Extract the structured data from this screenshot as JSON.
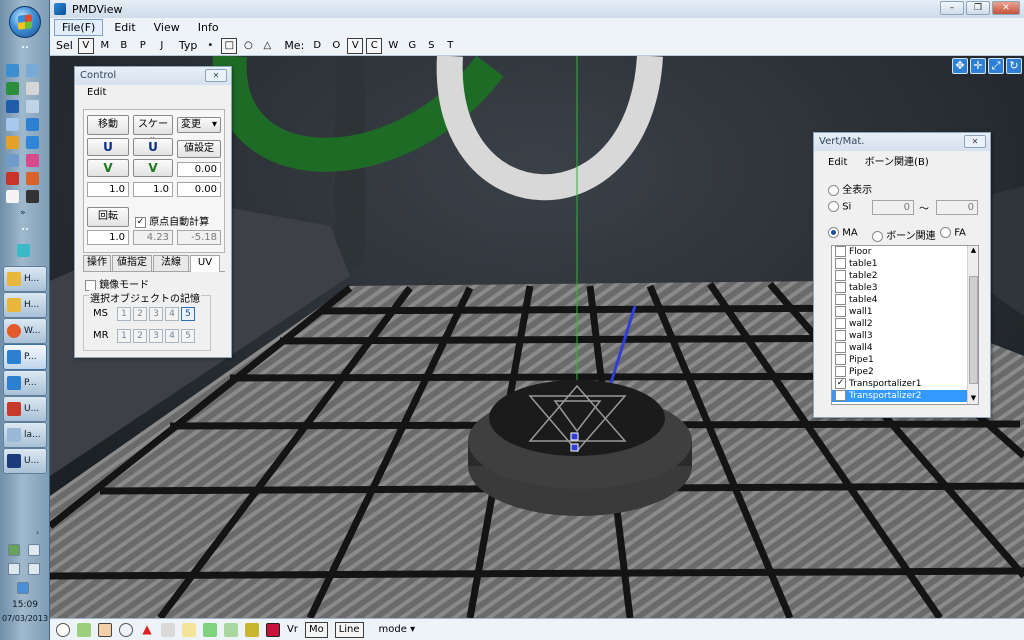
{
  "window": {
    "title": "PMDView",
    "controls": [
      "–",
      "❐",
      "✕"
    ]
  },
  "menubar": [
    "File(F)",
    "Edit",
    "View",
    "Info"
  ],
  "toolbar": {
    "sel_label": "Sel",
    "sel_items": [
      "V",
      "M",
      "B",
      "P",
      "J"
    ],
    "typ_label": "Typ",
    "typ_items": [
      "•",
      "□",
      "○",
      "△"
    ],
    "me_label": "Me:",
    "me_items": [
      "D",
      "O",
      "V",
      "C",
      "W",
      "G",
      "S",
      "T"
    ]
  },
  "control_panel": {
    "title": "Control",
    "menu": "Edit",
    "move_button": "移動",
    "scale_button": "スケール",
    "change_select": "変更",
    "u_label": "U",
    "v_label": "V",
    "set_value_button": "値設定",
    "field_a": "1.0",
    "field_b": "1.0",
    "field_c": "0.00",
    "field_d": "0.00",
    "rotate_button": "回転",
    "auto_origin_label": "原点自動計算",
    "auto_origin_checked": true,
    "field_e": "1.0",
    "field_f": "4.23",
    "field_g": "-5.18",
    "tabs": [
      "操作",
      "値指定",
      "法線",
      "UV"
    ],
    "active_tab": "UV",
    "mirror_label": "鏡像モード",
    "memory_group": "選択オブジェクトの記憶",
    "ms_label": "MS",
    "mr_label": "MR",
    "slots": [
      "1",
      "2",
      "3",
      "4",
      "5"
    ]
  },
  "vertmat_panel": {
    "title": "Vert/Mat.",
    "menu": [
      "Edit",
      "ボーン関連(B)"
    ],
    "all_label": "全表示",
    "si_label": "Si",
    "si_from": "0",
    "tilde": "〜",
    "si_to": "0",
    "ma_label": "MA",
    "bone_label": "ボーン関連",
    "fa_label": "FA",
    "items": [
      {
        "name": "Floor",
        "checked": false,
        "selected": false
      },
      {
        "name": "table1",
        "checked": false,
        "selected": false
      },
      {
        "name": "table2",
        "checked": false,
        "selected": false
      },
      {
        "name": "table3",
        "checked": false,
        "selected": false
      },
      {
        "name": "table4",
        "checked": false,
        "selected": false
      },
      {
        "name": "wall1",
        "checked": false,
        "selected": false
      },
      {
        "name": "wall2",
        "checked": false,
        "selected": false
      },
      {
        "name": "wall3",
        "checked": false,
        "selected": false
      },
      {
        "name": "wall4",
        "checked": false,
        "selected": false
      },
      {
        "name": "Pipe1",
        "checked": false,
        "selected": false
      },
      {
        "name": "Pipe2",
        "checked": false,
        "selected": false
      },
      {
        "name": "Transportalizer1",
        "checked": true,
        "selected": false
      },
      {
        "name": "Transportalizer2",
        "checked": true,
        "selected": true
      }
    ]
  },
  "statusbar": {
    "vr_label": "Vr",
    "line_label": "Line",
    "mode_label": "mode"
  },
  "taskbar": {
    "items": [
      "H...",
      "H...",
      "W...",
      "P...",
      "P...",
      "U...",
      "la...",
      "U..."
    ],
    "time": "15:09",
    "date": "07/03/2013"
  },
  "colors": {
    "accent": "#3399ff",
    "grid_line": "#1a1a1a",
    "tile": "#5a5a5a"
  }
}
